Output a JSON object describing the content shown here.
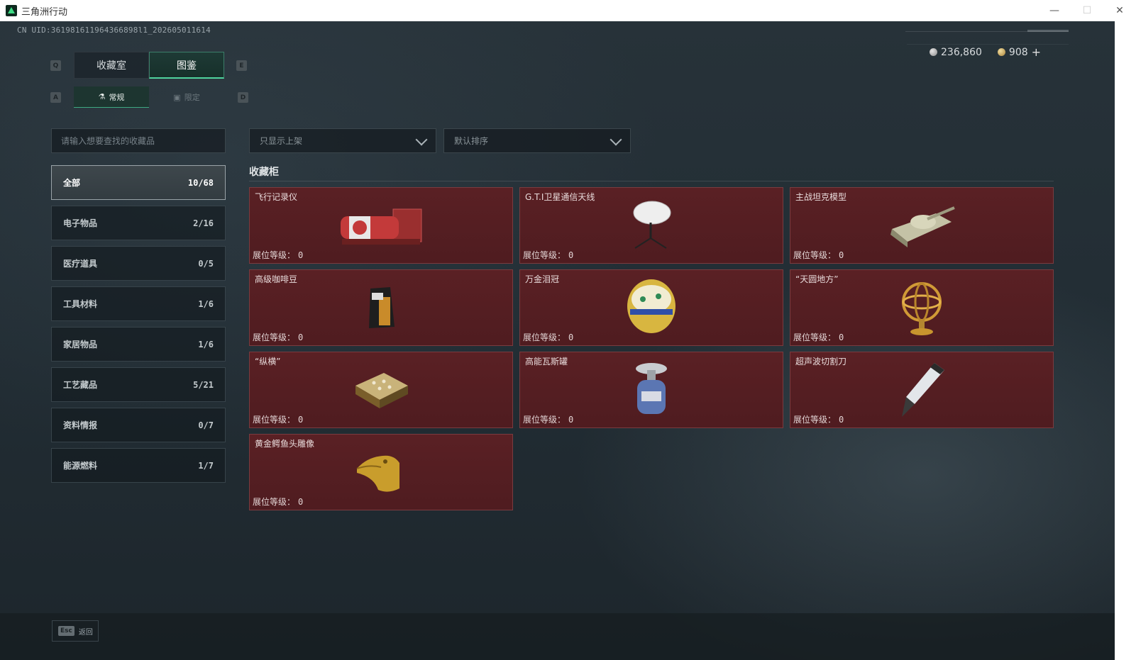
{
  "window": {
    "title": "三角洲行动",
    "minimize": "—",
    "maximize": "☐",
    "close": "✕"
  },
  "uid": "CN UID:361981611964366898l1_202605011614",
  "currency": [
    {
      "icon": "silver-coin-icon",
      "value": "236,860"
    },
    {
      "icon": "gold-coin-icon",
      "value": "908"
    }
  ],
  "currency_add": "+",
  "keys": {
    "prev_main": "Q",
    "next_main": "E",
    "prev_sub": "A",
    "next_sub": "D"
  },
  "main_tabs": [
    {
      "label": "收藏室",
      "active": false
    },
    {
      "label": "图鉴",
      "active": true
    }
  ],
  "sub_tabs": [
    {
      "label": "常规",
      "icon": "vial-icon",
      "active": true
    },
    {
      "label": "限定",
      "icon": "frame-icon",
      "active": false
    }
  ],
  "search": {
    "placeholder": "请输入想要查找的收藏品"
  },
  "filter": {
    "selected": "只显示上架"
  },
  "sort": {
    "selected": "默认排序"
  },
  "categories": [
    {
      "label": "全部",
      "count": "10/68",
      "active": true
    },
    {
      "label": "电子物品",
      "count": "2/16"
    },
    {
      "label": "医疗道具",
      "count": "0/5"
    },
    {
      "label": "工具材料",
      "count": "1/6"
    },
    {
      "label": "家居物品",
      "count": "1/6"
    },
    {
      "label": "工艺藏品",
      "count": "5/21"
    },
    {
      "label": "资料情报",
      "count": "0/7"
    },
    {
      "label": "能源燃料",
      "count": "1/7"
    }
  ],
  "cabinet": {
    "title": "收藏柜",
    "level_label": "展位等级：",
    "items": [
      {
        "name": "飞行记录仪",
        "level": "0",
        "icon": "flight-recorder-icon"
      },
      {
        "name": "G.T.I卫星通信天线",
        "level": "0",
        "icon": "satellite-antenna-icon"
      },
      {
        "name": "主战坦克模型",
        "level": "0",
        "icon": "tank-model-icon"
      },
      {
        "name": "高级咖啡豆",
        "level": "0",
        "icon": "coffee-bag-icon"
      },
      {
        "name": "万金泪冠",
        "level": "0",
        "icon": "jeweled-egg-icon"
      },
      {
        "name": "“天圆地方”",
        "level": "0",
        "icon": "armillary-sphere-icon"
      },
      {
        "name": "“纵横”",
        "level": "0",
        "icon": "chessboard-icon"
      },
      {
        "name": "高能瓦斯罐",
        "level": "0",
        "icon": "gas-canister-icon"
      },
      {
        "name": "超声波切割刀",
        "level": "0",
        "icon": "ultrasonic-knife-icon"
      },
      {
        "name": "黄金鳄鱼头雕像",
        "level": "0",
        "icon": "gold-crocodile-statue-icon"
      }
    ]
  },
  "footer": {
    "esc_key": "Esc",
    "back_label": "返回"
  }
}
